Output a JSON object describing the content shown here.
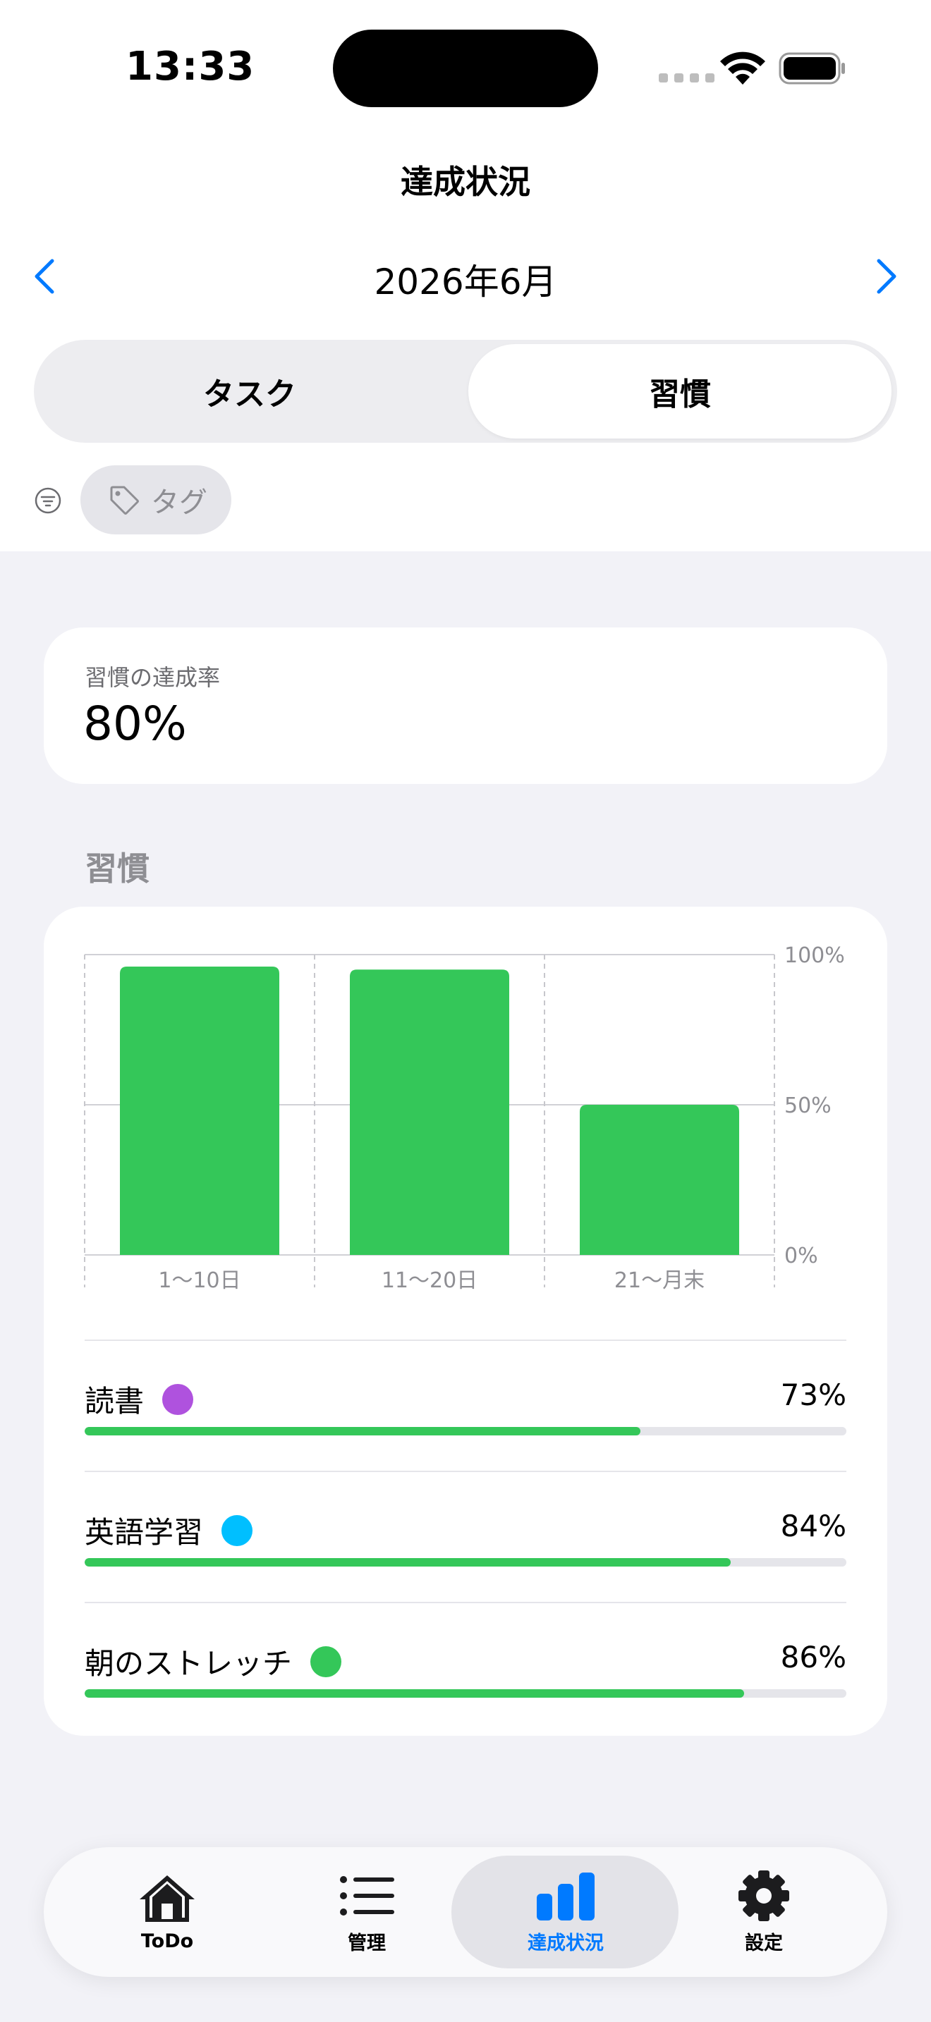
{
  "status": {
    "time": "13:33"
  },
  "header": {
    "title": "達成状況"
  },
  "month": {
    "label": "2026年6月"
  },
  "segments": {
    "left": "タスク",
    "right": "習慣",
    "selected": "習慣"
  },
  "filter": {
    "tag_label": "タグ"
  },
  "rate_card": {
    "label": "習慣の達成率",
    "value": "80%"
  },
  "section": {
    "title": "習慣"
  },
  "chart_data": {
    "type": "bar",
    "categories": [
      "1〜10日",
      "11〜20日",
      "21〜月末"
    ],
    "values": [
      96,
      95,
      50
    ],
    "y_ticks": [
      "100%",
      "50%",
      "0%"
    ],
    "ylim": [
      0,
      100
    ],
    "bar_color": "#34C759",
    "grid": true
  },
  "habits": [
    {
      "name": "読書",
      "percent": "73%",
      "rate": 0.73,
      "dot_color": "#AF52DE"
    },
    {
      "name": "英語学習",
      "percent": "84%",
      "rate": 0.848,
      "dot_color": "#00BFFF"
    },
    {
      "name": "朝のストレッチ",
      "percent": "86%",
      "rate": 0.866,
      "dot_color": "#34C759"
    }
  ],
  "tabbar": {
    "tabs": [
      {
        "label": "ToDo",
        "icon": "house-icon"
      },
      {
        "label": "管理",
        "icon": "list-icon"
      },
      {
        "label": "達成状況",
        "icon": "chart-bar-icon",
        "active": true
      },
      {
        "label": "設定",
        "icon": "gear-icon"
      }
    ],
    "accent": "#007AFF"
  }
}
